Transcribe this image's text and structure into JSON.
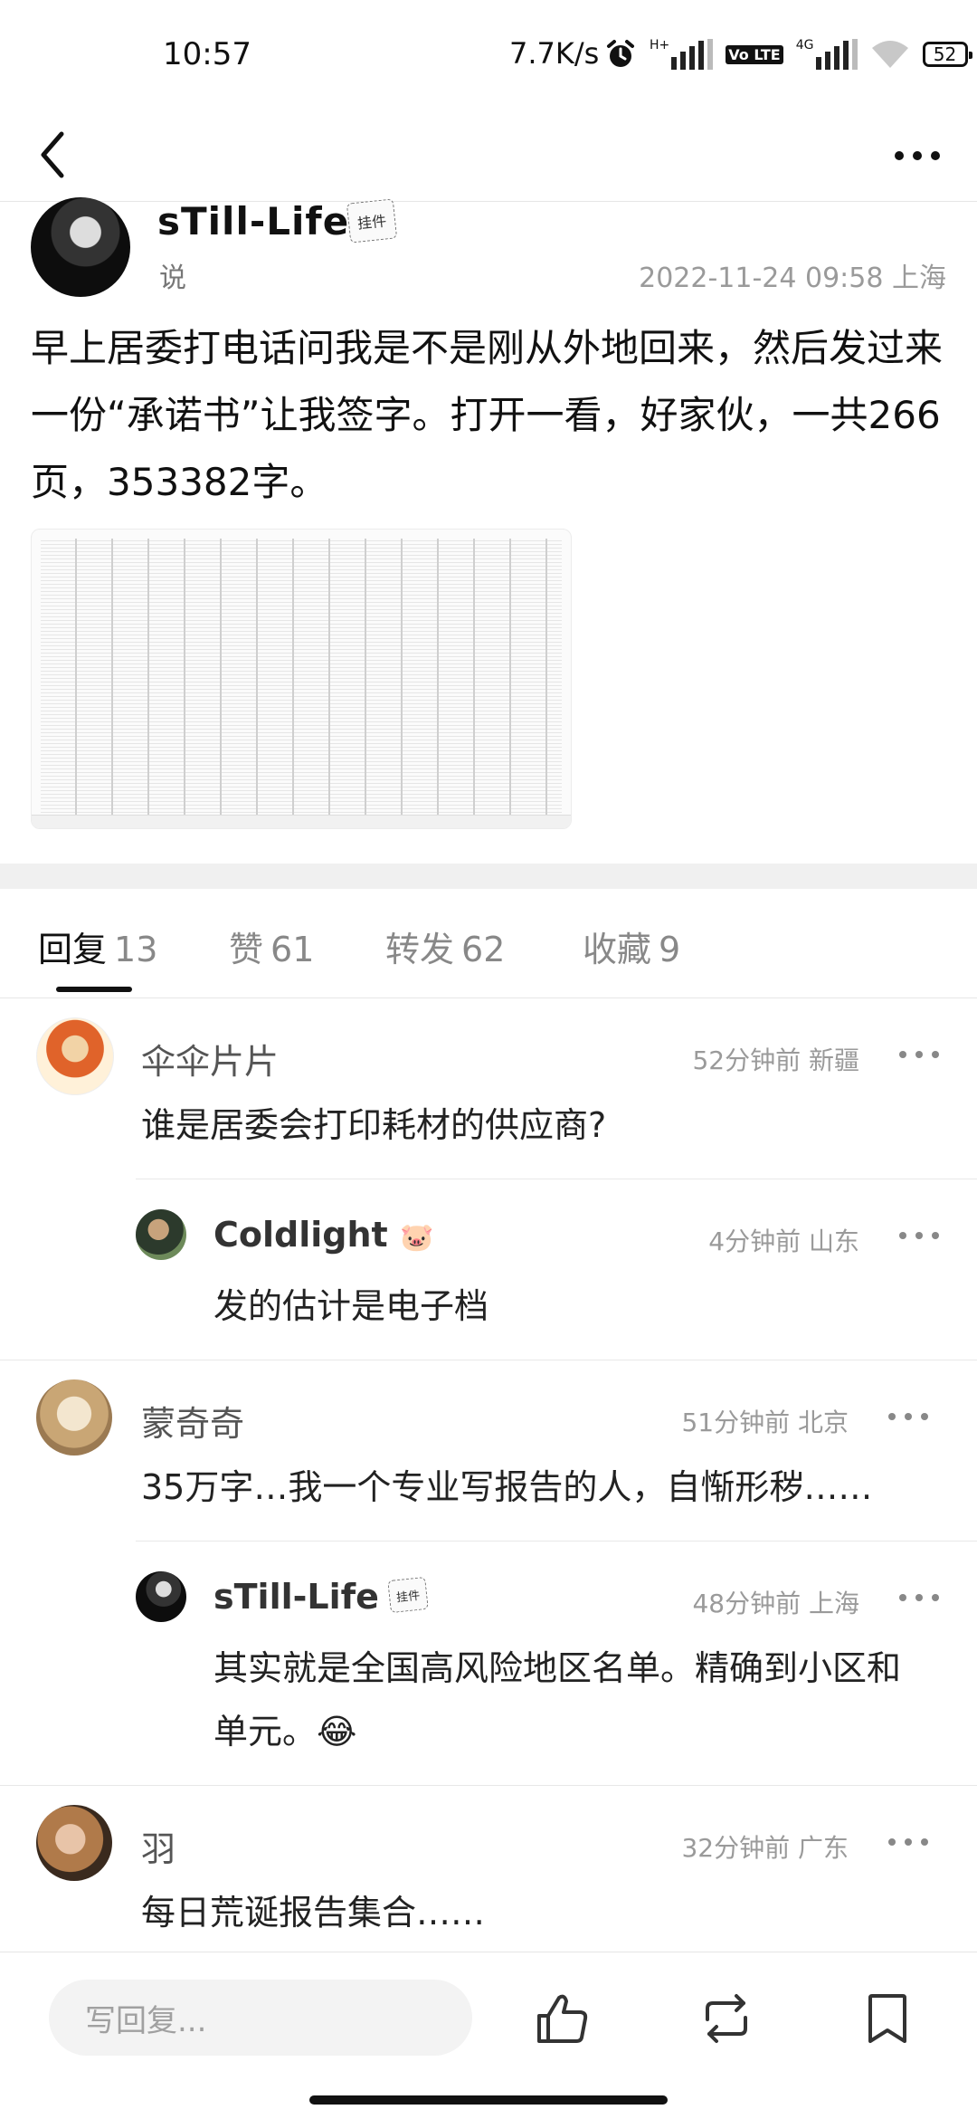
{
  "status_bar": {
    "time": "10:57",
    "speed": "7.7K/s",
    "battery": "52",
    "net1": "H+",
    "net2": "4G",
    "volte": "Vo LTE"
  },
  "post": {
    "author": "sTill-Life",
    "pendant": "挂件",
    "subtitle": "说",
    "meta": "2022-11-24 09:58 上海",
    "text": "早上居委打电话问我是不是刚从外地回来，然后发过来一份“承诺书”让我签字。打开一看，好家伙，一共266页，353382字。"
  },
  "tabs": [
    {
      "label": "回复",
      "count": "13"
    },
    {
      "label": "赞",
      "count": "61"
    },
    {
      "label": "转发",
      "count": "62"
    },
    {
      "label": "收藏",
      "count": "9"
    }
  ],
  "comments": [
    {
      "name": "伞伞片片",
      "meta": "52分钟前 新疆",
      "text": "谁是居委会打印耗材的供应商?"
    },
    {
      "name": "Coldlight",
      "meta": "4分钟前 山东",
      "text": "发的估计是电子档",
      "badge": "🐷"
    },
    {
      "name": "蒙奇奇",
      "meta": "51分钟前 北京",
      "text": "35万字…我一个专业写报告的人，自惭形秽……"
    },
    {
      "name": "sTill-Life",
      "meta": "48分钟前 上海",
      "text": "其实就是全国高风险地区名单。精确到小区和单元。😂",
      "pendant": "挂件"
    },
    {
      "name": "羽",
      "meta": "32分钟前 广东",
      "text": "每日荒诞报告集合……"
    }
  ],
  "bottom_bar": {
    "placeholder": "写回复..."
  },
  "icons": {
    "back": "back-arrow-icon",
    "more": "more-dots-icon",
    "like": "thumbs-up-icon",
    "repost": "repost-icon",
    "bookmark": "bookmark-icon"
  },
  "colors": {
    "text": "#222222",
    "muted": "#9a9a9a",
    "divider": "#e8e8e8",
    "band": "#f0f0f0"
  }
}
